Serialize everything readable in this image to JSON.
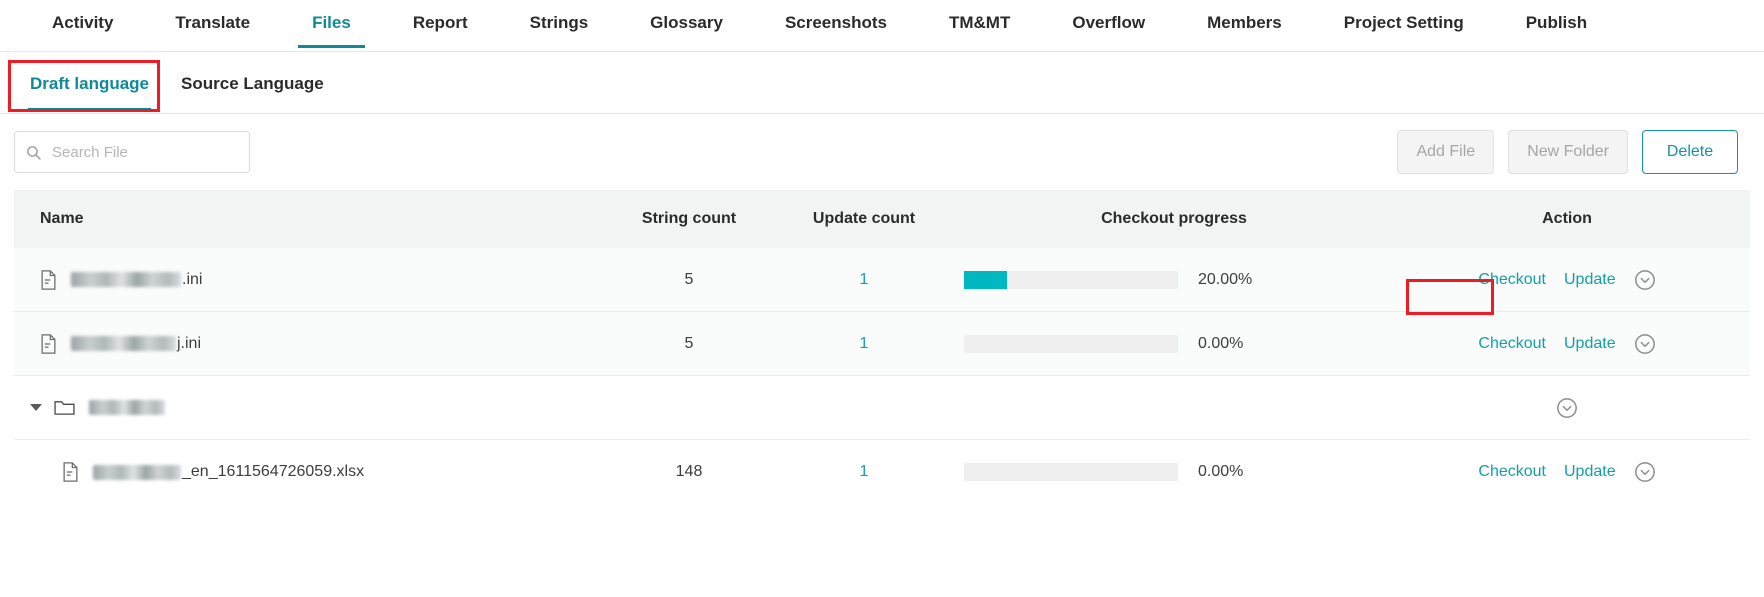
{
  "topnav": {
    "items": [
      {
        "label": "Activity",
        "active": false
      },
      {
        "label": "Translate",
        "active": false
      },
      {
        "label": "Files",
        "active": true
      },
      {
        "label": "Report",
        "active": false
      },
      {
        "label": "Strings",
        "active": false
      },
      {
        "label": "Glossary",
        "active": false
      },
      {
        "label": "Screenshots",
        "active": false
      },
      {
        "label": "TM&MT",
        "active": false
      },
      {
        "label": "Overflow",
        "active": false
      },
      {
        "label": "Members",
        "active": false
      },
      {
        "label": "Project Setting",
        "active": false
      },
      {
        "label": "Publish",
        "active": false
      }
    ]
  },
  "subtabs": {
    "items": [
      {
        "label": "Draft language",
        "active": true
      },
      {
        "label": "Source Language",
        "active": false
      }
    ]
  },
  "toolbar": {
    "search_placeholder": "Search File",
    "search_value": "",
    "search_icon": "search-icon",
    "add_file_label": "Add File",
    "new_folder_label": "New Folder",
    "delete_label": "Delete"
  },
  "table": {
    "headers": {
      "name": "Name",
      "string_count": "String count",
      "update_count": "Update count",
      "checkout_progress": "Checkout progress",
      "action": "Action"
    },
    "rows": [
      {
        "type": "file",
        "icon": "file-icon",
        "name_redacted": true,
        "name_suffix": ".ini",
        "string_count": "5",
        "update_count": "1",
        "progress_percent": 20,
        "progress_label": "20.00%",
        "checkout_label": "Checkout",
        "update_label": "Update",
        "expand_icon": "chevron-down-circle-icon"
      },
      {
        "type": "file",
        "icon": "file-icon",
        "name_redacted": true,
        "name_suffix": "j.ini",
        "string_count": "5",
        "update_count": "1",
        "progress_percent": 0,
        "progress_label": "0.00%",
        "checkout_label": "Checkout",
        "update_label": "Update",
        "expand_icon": "chevron-down-circle-icon"
      },
      {
        "type": "folder",
        "icon": "folder-icon",
        "caret_icon": "caret-down-icon",
        "name_redacted": true,
        "name_suffix": "",
        "string_count": "",
        "update_count": "",
        "progress_percent": null,
        "progress_label": "",
        "checkout_label": "",
        "update_label": "",
        "expand_icon": "chevron-down-circle-icon"
      },
      {
        "type": "file-child",
        "icon": "file-icon",
        "name_redacted": true,
        "name_suffix": "_en_1611564726059.xlsx",
        "string_count": "148",
        "update_count": "1",
        "progress_percent": 0,
        "progress_label": "0.00%",
        "checkout_label": "Checkout",
        "update_label": "Update",
        "expand_icon": "chevron-down-circle-icon"
      }
    ]
  },
  "annotations": {
    "highlight_color": "#ee1c24",
    "accent_color": "#108a96",
    "progress_color": "#00b8c0"
  }
}
